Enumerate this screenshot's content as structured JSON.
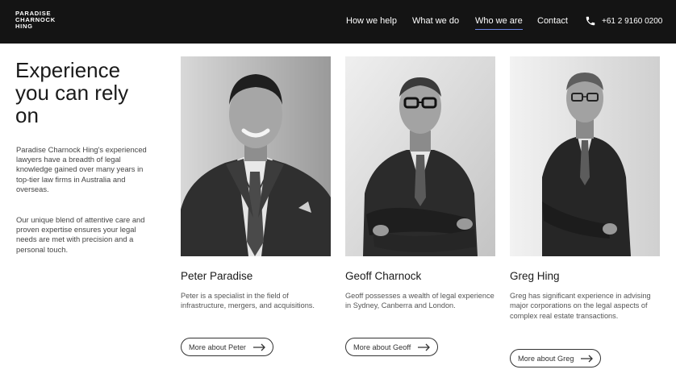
{
  "header": {
    "logo_lines": [
      "PARADISE",
      "CHARNOCK",
      "HING"
    ],
    "nav": [
      {
        "label": "How we help"
      },
      {
        "label": "What we do"
      },
      {
        "label": "Who we are",
        "active": true
      },
      {
        "label": "Contact"
      }
    ],
    "phone_icon": "phone-icon",
    "phone": "+61 2 9160 0200",
    "background": "#141414",
    "active_underline": "#6f88e8"
  },
  "intro": {
    "heading_lines": [
      "Experience",
      "you can rely",
      "on"
    ],
    "paragraph1": "Paradise Charnock Hing's experienced lawyers have a breadth of legal knowledge gained over many years in top-tier law firms in Australia and overseas.",
    "paragraph2": "Our unique blend of attentive care and proven expertise ensures your legal needs are met with precision and a personal touch."
  },
  "team": [
    {
      "name": "Peter Paradise",
      "description": "Peter is a specialist in the field of infrastructure, mergers, and acquisitions.",
      "button": "More about Peter"
    },
    {
      "name": "Geoff Charnock",
      "description": "Geoff possesses a wealth of legal experience in Sydney, Canberra and London.",
      "button": "More about Geoff"
    },
    {
      "name": "Greg Hing",
      "description": "Greg has significant experience in advising major corporations on the legal aspects of complex real estate transactions.",
      "button": "More about Greg"
    }
  ]
}
